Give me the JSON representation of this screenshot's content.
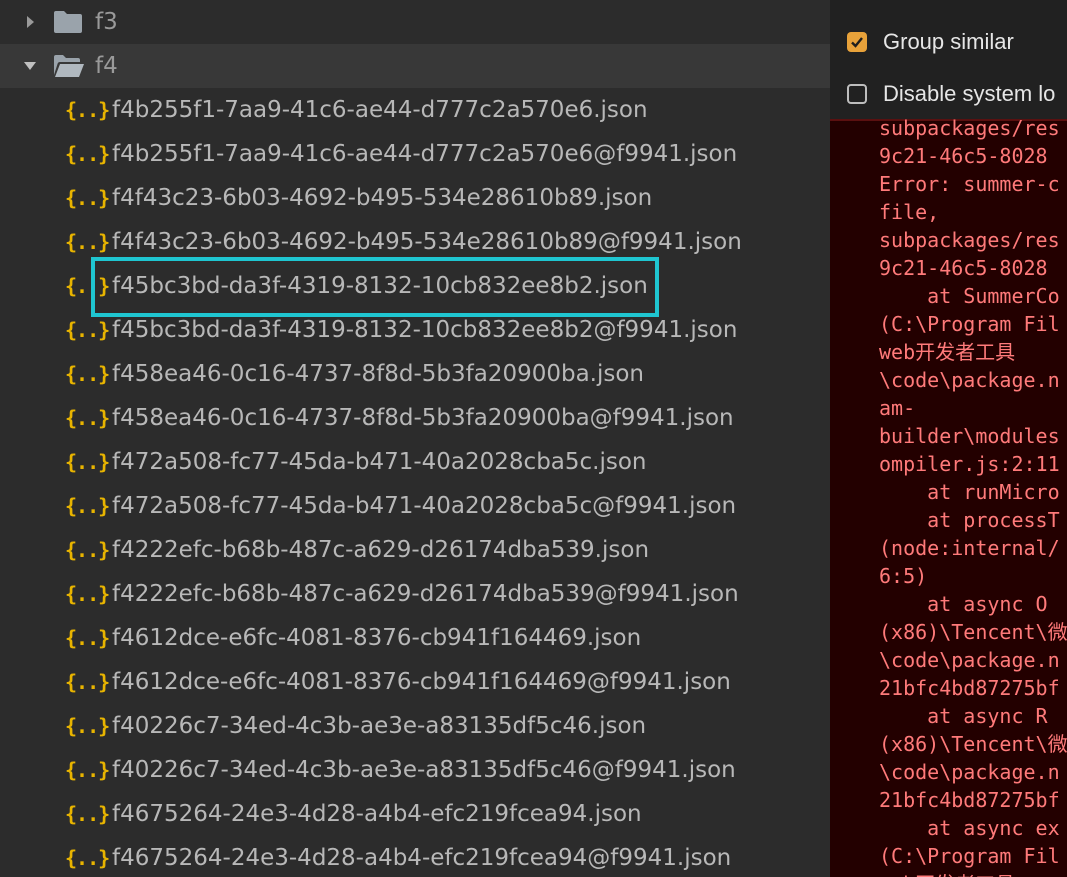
{
  "tree": {
    "folders": [
      {
        "name": "f3",
        "expanded": false
      },
      {
        "name": "f4",
        "expanded": true
      }
    ],
    "files": [
      "f4b255f1-7aa9-41c6-ae44-d777c2a570e6.json",
      "f4b255f1-7aa9-41c6-ae44-d777c2a570e6@f9941.json",
      "f4f43c23-6b03-4692-b495-534e28610b89.json",
      "f4f43c23-6b03-4692-b495-534e28610b89@f9941.json",
      "f45bc3bd-da3f-4319-8132-10cb832ee8b2.json",
      "f45bc3bd-da3f-4319-8132-10cb832ee8b2@f9941.json",
      "f458ea46-0c16-4737-8f8d-5b3fa20900ba.json",
      "f458ea46-0c16-4737-8f8d-5b3fa20900ba@f9941.json",
      "f472a508-fc77-45da-b471-40a2028cba5c.json",
      "f472a508-fc77-45da-b471-40a2028cba5c@f9941.json",
      "f4222efc-b68b-487c-a629-d26174dba539.json",
      "f4222efc-b68b-487c-a629-d26174dba539@f9941.json",
      "f4612dce-e6fc-4081-8376-cb941f164469.json",
      "f4612dce-e6fc-4081-8376-cb941f164469@f9941.json",
      "f40226c7-34ed-4c3b-ae3e-a83135df5c46.json",
      "f40226c7-34ed-4c3b-ae3e-a83135df5c46@f9941.json",
      "f4675264-24e3-4d28-a4b4-efc219fcea94.json",
      "f4675264-24e3-4d28-a4b4-efc219fcea94@f9941.json"
    ],
    "highlighted_file": "f45bc3bd-da3f-4319-8132-10cb832ee8b2.json",
    "file_icon_glyph": "{..}",
    "colors": {
      "file_icon": "#e8b400",
      "highlight": "#1fc6d1",
      "text": "#b8b8b8"
    }
  },
  "console": {
    "options": [
      {
        "label": "Group similar",
        "checked": true
      },
      {
        "label": "Disable system lo",
        "checked": false
      }
    ],
    "log_lines": [
      "subpackages/res",
      "9c21-46c5-8028",
      "Error: summer-c",
      "file,",
      "subpackages/res",
      "9c21-46c5-8028",
      "    at SummerCo",
      "(C:\\Program Fil",
      "web开发者工具",
      "\\code\\package.n",
      "am-",
      "builder\\modules",
      "ompiler.js:2:11",
      "    at runMicro",
      "    at processT",
      "(node:internal/",
      "6:5)",
      "    at async O",
      "(x86)\\Tencent\\微",
      "\\code\\package.n",
      "21bfc4bd87275bf",
      "    at async R",
      "(x86)\\Tencent\\微",
      "\\code\\package.n",
      "21bfc4bd87275bf",
      "    at async ex",
      "(C:\\Program Fil",
      "web开发者工具"
    ],
    "colors": {
      "background": "#230000",
      "text": "#ff7a7a",
      "checkbox_on": "#e8a23a"
    }
  }
}
